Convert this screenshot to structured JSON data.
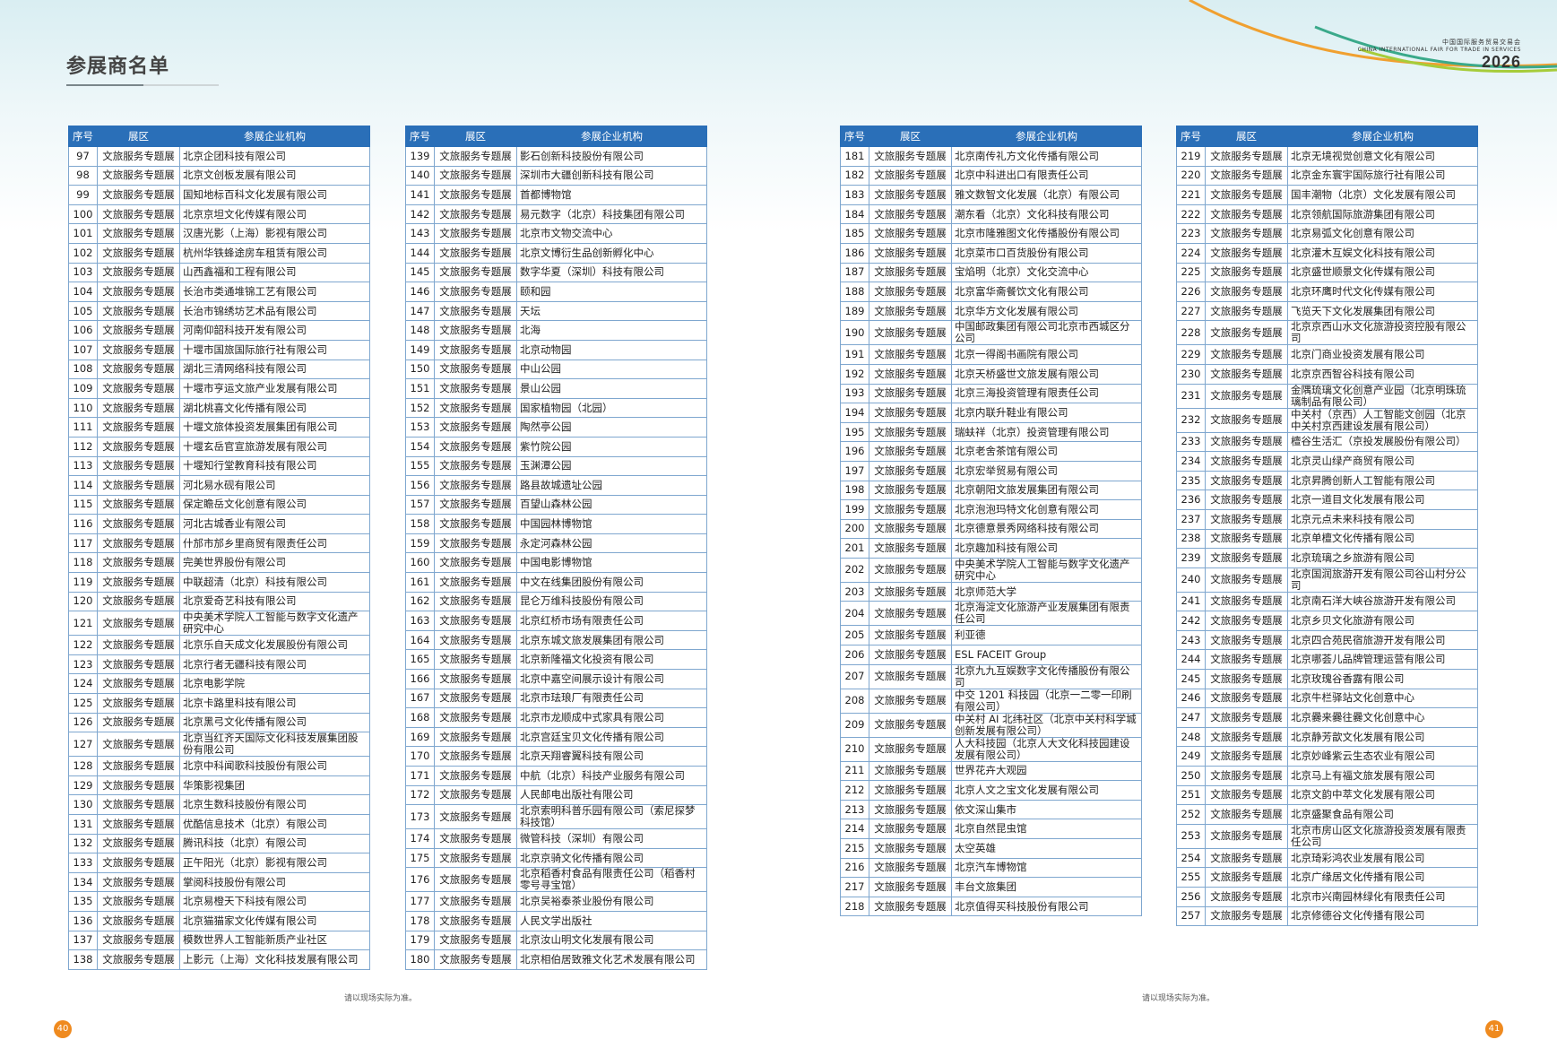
{
  "header": {
    "title": "参展商名单",
    "brand_cn": "中国国际服务贸易交易会",
    "brand_en": "CHINA INTERNATIONAL FAIR FOR TRADE IN SERVICES",
    "brand_year": "2026"
  },
  "columns": [
    "序号",
    "展区",
    "参展企业机构"
  ],
  "tables": [
    {
      "rows": [
        [
          "97",
          "文旅服务专题展",
          "北京企团科技有限公司"
        ],
        [
          "98",
          "文旅服务专题展",
          "北京文创板发展有限公司"
        ],
        [
          "99",
          "文旅服务专题展",
          "国知地标百科文化发展有限公司"
        ],
        [
          "100",
          "文旅服务专题展",
          "北京京坦文化传媒有限公司"
        ],
        [
          "101",
          "文旅服务专题展",
          "汉唐光影（上海）影视有限公司"
        ],
        [
          "102",
          "文旅服务专题展",
          "杭州华铁蜂途房车租赁有限公司"
        ],
        [
          "103",
          "文旅服务专题展",
          "山西鑫福和工程有限公司"
        ],
        [
          "104",
          "文旅服务专题展",
          "长治市类通堆锦工艺有限公司"
        ],
        [
          "105",
          "文旅服务专题展",
          "长治市锦绣坊艺术品有限公司"
        ],
        [
          "106",
          "文旅服务专题展",
          "河南仰韶科技开发有限公司"
        ],
        [
          "107",
          "文旅服务专题展",
          "十堰市国旅国际旅行社有限公司"
        ],
        [
          "108",
          "文旅服务专题展",
          "湖北三清网络科技有限公司"
        ],
        [
          "109",
          "文旅服务专题展",
          "十堰市亨运文旅产业发展有限公司"
        ],
        [
          "110",
          "文旅服务专题展",
          "湖北桃喜文化传播有限公司"
        ],
        [
          "111",
          "文旅服务专题展",
          "十堰文旅体投资发展集团有限公司"
        ],
        [
          "112",
          "文旅服务专题展",
          "十堰玄岳官宣旅游发展有限公司"
        ],
        [
          "113",
          "文旅服务专题展",
          "十堰知行堂教育科技有限公司"
        ],
        [
          "114",
          "文旅服务专题展",
          "河北易水砚有限公司"
        ],
        [
          "115",
          "文旅服务专题展",
          "保定瞻岳文化创意有限公司"
        ],
        [
          "116",
          "文旅服务专题展",
          "河北古城香业有限公司"
        ],
        [
          "117",
          "文旅服务专题展",
          "什邡市邡乡里商贸有限责任公司"
        ],
        [
          "118",
          "文旅服务专题展",
          "完美世界股份有限公司"
        ],
        [
          "119",
          "文旅服务专题展",
          "中联超清（北京）科技有限公司"
        ],
        [
          "120",
          "文旅服务专题展",
          "北京爱奇艺科技有限公司"
        ],
        [
          "121",
          "文旅服务专题展",
          "中央美术学院人工智能与数字文化遗产研究中心"
        ],
        [
          "122",
          "文旅服务专题展",
          "北京乐自天成文化发展股份有限公司"
        ],
        [
          "123",
          "文旅服务专题展",
          "北京行者无疆科技有限公司"
        ],
        [
          "124",
          "文旅服务专题展",
          "北京电影学院"
        ],
        [
          "125",
          "文旅服务专题展",
          "北京卡路里科技有限公司"
        ],
        [
          "126",
          "文旅服务专题展",
          "北京黑弓文化传播有限公司"
        ],
        [
          "127",
          "文旅服务专题展",
          "北京当红齐天国际文化科技发展集团股份有限公司"
        ],
        [
          "128",
          "文旅服务专题展",
          "北京中科闻歌科技股份有限公司"
        ],
        [
          "129",
          "文旅服务专题展",
          "华策影视集团"
        ],
        [
          "130",
          "文旅服务专题展",
          "北京生数科技股份有限公司"
        ],
        [
          "131",
          "文旅服务专题展",
          "优酷信息技术（北京）有限公司"
        ],
        [
          "132",
          "文旅服务专题展",
          "腾讯科技（北京）有限公司"
        ],
        [
          "133",
          "文旅服务专题展",
          "正午阳光（北京）影视有限公司"
        ],
        [
          "134",
          "文旅服务专题展",
          "掌阅科技股份有限公司"
        ],
        [
          "135",
          "文旅服务专题展",
          "北京易橙天下科技有限公司"
        ],
        [
          "136",
          "文旅服务专题展",
          "北京猫猫家文化传媒有限公司"
        ],
        [
          "137",
          "文旅服务专题展",
          "模数世界人工智能新质产业社区"
        ],
        [
          "138",
          "文旅服务专题展",
          "上影元（上海）文化科技发展有限公司"
        ]
      ]
    },
    {
      "rows": [
        [
          "139",
          "文旅服务专题展",
          "影石创新科技股份有限公司"
        ],
        [
          "140",
          "文旅服务专题展",
          "深圳市大疆创新科技有限公司"
        ],
        [
          "141",
          "文旅服务专题展",
          "首都博物馆"
        ],
        [
          "142",
          "文旅服务专题展",
          "易元数字（北京）科技集团有限公司"
        ],
        [
          "143",
          "文旅服务专题展",
          "北京市文物交流中心"
        ],
        [
          "144",
          "文旅服务专题展",
          "北京文博衍生品创新孵化中心"
        ],
        [
          "145",
          "文旅服务专题展",
          "数字华夏（深圳）科技有限公司"
        ],
        [
          "146",
          "文旅服务专题展",
          "颐和园"
        ],
        [
          "147",
          "文旅服务专题展",
          "天坛"
        ],
        [
          "148",
          "文旅服务专题展",
          "北海"
        ],
        [
          "149",
          "文旅服务专题展",
          "北京动物园"
        ],
        [
          "150",
          "文旅服务专题展",
          "中山公园"
        ],
        [
          "151",
          "文旅服务专题展",
          "景山公园"
        ],
        [
          "152",
          "文旅服务专题展",
          "国家植物园（北园）"
        ],
        [
          "153",
          "文旅服务专题展",
          "陶然亭公园"
        ],
        [
          "154",
          "文旅服务专题展",
          "紫竹院公园"
        ],
        [
          "155",
          "文旅服务专题展",
          "玉渊潭公园"
        ],
        [
          "156",
          "文旅服务专题展",
          "路县故城遗址公园"
        ],
        [
          "157",
          "文旅服务专题展",
          "百望山森林公园"
        ],
        [
          "158",
          "文旅服务专题展",
          "中国园林博物馆"
        ],
        [
          "159",
          "文旅服务专题展",
          "永定河森林公园"
        ],
        [
          "160",
          "文旅服务专题展",
          "中国电影博物馆"
        ],
        [
          "161",
          "文旅服务专题展",
          "中文在线集团股份有限公司"
        ],
        [
          "162",
          "文旅服务专题展",
          "昆仑万维科技股份有限公司"
        ],
        [
          "163",
          "文旅服务专题展",
          "北京红桥市场有限责任公司"
        ],
        [
          "164",
          "文旅服务专题展",
          "北京东城文旅发展集团有限公司"
        ],
        [
          "165",
          "文旅服务专题展",
          "北京新隆福文化投资有限公司"
        ],
        [
          "166",
          "文旅服务专题展",
          "北京中嘉空间展示设计有限公司"
        ],
        [
          "167",
          "文旅服务专题展",
          "北京市珐琅厂有限责任公司"
        ],
        [
          "168",
          "文旅服务专题展",
          "北京市龙顺成中式家具有限公司"
        ],
        [
          "169",
          "文旅服务专题展",
          "北京宫廷宝贝文化传播有限公司"
        ],
        [
          "170",
          "文旅服务专题展",
          "北京天翔睿翼科技有限公司"
        ],
        [
          "171",
          "文旅服务专题展",
          "中航（北京）科技产业服务有限公司"
        ],
        [
          "172",
          "文旅服务专题展",
          "人民邮电出版社有限公司"
        ],
        [
          "173",
          "文旅服务专题展",
          "北京索明科普乐园有限公司（索尼探梦科技馆）"
        ],
        [
          "174",
          "文旅服务专题展",
          "微管科技（深圳）有限公司"
        ],
        [
          "175",
          "文旅服务专题展",
          "北京京骑文化传播有限公司"
        ],
        [
          "176",
          "文旅服务专题展",
          "北京稻香村食品有限责任公司（稻香村零号寻宝馆）"
        ],
        [
          "177",
          "文旅服务专题展",
          "北京吴裕泰茶业股份有限公司"
        ],
        [
          "178",
          "文旅服务专题展",
          "人民文学出版社"
        ],
        [
          "179",
          "文旅服务专题展",
          "北京汝山明文化发展有限公司"
        ],
        [
          "180",
          "文旅服务专题展",
          "北京相伯居致雅文化艺术发展有限公司"
        ]
      ]
    },
    {
      "rows": [
        [
          "181",
          "文旅服务专题展",
          "北京南传礼方文化传播有限公司"
        ],
        [
          "182",
          "文旅服务专题展",
          "北京中科进出口有限责任公司"
        ],
        [
          "183",
          "文旅服务专题展",
          "雅文数智文化发展（北京）有限公司"
        ],
        [
          "184",
          "文旅服务专题展",
          "潮东看（北京）文化科技有限公司"
        ],
        [
          "185",
          "文旅服务专题展",
          "北京市隆雅图文化传播股份有限公司"
        ],
        [
          "186",
          "文旅服务专题展",
          "北京菜市口百货股份有限公司"
        ],
        [
          "187",
          "文旅服务专题展",
          "宝焰明（北京）文化交流中心"
        ],
        [
          "188",
          "文旅服务专题展",
          "北京富华斋餐饮文化有限公司"
        ],
        [
          "189",
          "文旅服务专题展",
          "北京华方文化发展有限公司"
        ],
        [
          "190",
          "文旅服务专题展",
          "中国邮政集团有限公司北京市西城区分公司"
        ],
        [
          "191",
          "文旅服务专题展",
          "北京一得阁书画院有限公司"
        ],
        [
          "192",
          "文旅服务专题展",
          "北京天桥盛世文旅发展有限公司"
        ],
        [
          "193",
          "文旅服务专题展",
          "北京三海投资管理有限责任公司"
        ],
        [
          "194",
          "文旅服务专题展",
          "北京内联升鞋业有限公司"
        ],
        [
          "195",
          "文旅服务专题展",
          "瑞蚨祥（北京）投资管理有限公司"
        ],
        [
          "196",
          "文旅服务专题展",
          "北京老舍茶馆有限公司"
        ],
        [
          "197",
          "文旅服务专题展",
          "北京宏举贸易有限公司"
        ],
        [
          "198",
          "文旅服务专题展",
          "北京朝阳文旅发展集团有限公司"
        ],
        [
          "199",
          "文旅服务专题展",
          "北京泡泡玛特文化创意有限公司"
        ],
        [
          "200",
          "文旅服务专题展",
          "北京德意景秀网络科技有限公司"
        ],
        [
          "201",
          "文旅服务专题展",
          "北京趣加科技有限公司"
        ],
        [
          "202",
          "文旅服务专题展",
          "中央美术学院人工智能与数字文化遗产研究中心"
        ],
        [
          "203",
          "文旅服务专题展",
          "北京师范大学"
        ],
        [
          "204",
          "文旅服务专题展",
          "北京海淀文化旅游产业发展集团有限责任公司"
        ],
        [
          "205",
          "文旅服务专题展",
          "利亚德"
        ],
        [
          "206",
          "文旅服务专题展",
          "ESL FACEIT Group"
        ],
        [
          "207",
          "文旅服务专题展",
          "北京九九互娱数字文化传播股份有限公司"
        ],
        [
          "208",
          "文旅服务专题展",
          "中交 1201 科技园（北京一二零一印刷有限公司）"
        ],
        [
          "209",
          "文旅服务专题展",
          "中关村 AI 北纬社区（北京中关村科学城创新发展有限公司）"
        ],
        [
          "210",
          "文旅服务专题展",
          "人大科技园（北京人大文化科技园建设发展有限公司）"
        ],
        [
          "211",
          "文旅服务专题展",
          "世界花卉大观园"
        ],
        [
          "212",
          "文旅服务专题展",
          "北京人文之宝文化发展有限公司"
        ],
        [
          "213",
          "文旅服务专题展",
          "依文深山集市"
        ],
        [
          "214",
          "文旅服务专题展",
          "北京自然昆虫馆"
        ],
        [
          "215",
          "文旅服务专题展",
          "太空英雄"
        ],
        [
          "216",
          "文旅服务专题展",
          "北京汽车博物馆"
        ],
        [
          "217",
          "文旅服务专题展",
          "丰台文旅集团"
        ],
        [
          "218",
          "文旅服务专题展",
          "北京值得买科技股份有限公司"
        ]
      ]
    },
    {
      "rows": [
        [
          "219",
          "文旅服务专题展",
          "北京无境视觉创意文化有限公司"
        ],
        [
          "220",
          "文旅服务专题展",
          "北京金东寰宇国际旅行社有限公司"
        ],
        [
          "221",
          "文旅服务专题展",
          "国丰潮物（北京）文化发展有限公司"
        ],
        [
          "222",
          "文旅服务专题展",
          "北京领航国际旅游集团有限公司"
        ],
        [
          "223",
          "文旅服务专题展",
          "北京易弧文化创意有限公司"
        ],
        [
          "224",
          "文旅服务专题展",
          "北京灌木互娱文化科技有限公司"
        ],
        [
          "225",
          "文旅服务专题展",
          "北京盛世顺景文化传媒有限公司"
        ],
        [
          "226",
          "文旅服务专题展",
          "北京环鹰时代文化传媒有限公司"
        ],
        [
          "227",
          "文旅服务专题展",
          "飞览天下文化发展集团有限公司"
        ],
        [
          "228",
          "文旅服务专题展",
          "北京京西山水文化旅游投资控股有限公司"
        ],
        [
          "229",
          "文旅服务专题展",
          "北京门商业投资发展有限公司"
        ],
        [
          "230",
          "文旅服务专题展",
          "北京京西智谷科技有限公司"
        ],
        [
          "231",
          "文旅服务专题展",
          "金隅琉璃文化创意产业园（北京明珠琉璃制品有限公司）"
        ],
        [
          "232",
          "文旅服务专题展",
          "中关村（京西）人工智能文创园（北京中关村京西建设发展有限公司）"
        ],
        [
          "233",
          "文旅服务专题展",
          "檀谷生活汇（京投发展股份有限公司）"
        ],
        [
          "234",
          "文旅服务专题展",
          "北京灵山绿产商贸有限公司"
        ],
        [
          "235",
          "文旅服务专题展",
          "北京昇腾创新人工智能有限公司"
        ],
        [
          "236",
          "文旅服务专题展",
          "北京一道目文化发展有限公司"
        ],
        [
          "237",
          "文旅服务专题展",
          "北京元点未来科技有限公司"
        ],
        [
          "238",
          "文旅服务专题展",
          "北京单檀文化传播有限公司"
        ],
        [
          "239",
          "文旅服务专题展",
          "北京琉璃之乡旅游有限公司"
        ],
        [
          "240",
          "文旅服务专题展",
          "北京国润旅游开发有限公司谷山村分公司"
        ],
        [
          "241",
          "文旅服务专题展",
          "北京南石洋大峡谷旅游开发有限公司"
        ],
        [
          "242",
          "文旅服务专题展",
          "北京乡贝文化旅游有限公司"
        ],
        [
          "243",
          "文旅服务专题展",
          "北京四合苑民宿旅游开发有限公司"
        ],
        [
          "244",
          "文旅服务专题展",
          "北京哪荟儿品牌管理运营有限公司"
        ],
        [
          "245",
          "文旅服务专题展",
          "北京玫瑰谷香露有限公司"
        ],
        [
          "246",
          "文旅服务专题展",
          "北京牛栏驿站文化创意中心"
        ],
        [
          "247",
          "文旅服务专题展",
          "北京爨来爨往爨文化创意中心"
        ],
        [
          "248",
          "文旅服务专题展",
          "北京静芳歆文化发展有限公司"
        ],
        [
          "249",
          "文旅服务专题展",
          "北京妙峰紫云生态农业有限公司"
        ],
        [
          "250",
          "文旅服务专题展",
          "北京马上有福文旅发展有限公司"
        ],
        [
          "251",
          "文旅服务专题展",
          "北京文韵中萃文化发展有限公司"
        ],
        [
          "252",
          "文旅服务专题展",
          "北京盛聚食品有限公司"
        ],
        [
          "253",
          "文旅服务专题展",
          "北京市房山区文化旅游投资发展有限责任公司"
        ],
        [
          "254",
          "文旅服务专题展",
          "北京琦彩鸿农业发展有限公司"
        ],
        [
          "255",
          "文旅服务专题展",
          "北京广缘居文化传播有限公司"
        ],
        [
          "256",
          "文旅服务专题展",
          "北京市兴南园林绿化有限责任公司"
        ],
        [
          "257",
          "文旅服务专题展",
          "北京修德谷文化传播有限公司"
        ]
      ]
    }
  ],
  "footer": {
    "note_left": "请以现场实际为准。",
    "note_right": "请以现场实际为准。",
    "page_left": "40",
    "page_right": "41"
  },
  "colors": {
    "header_blue": "#2a6fb8",
    "page_badge": "#ef8a1f"
  }
}
